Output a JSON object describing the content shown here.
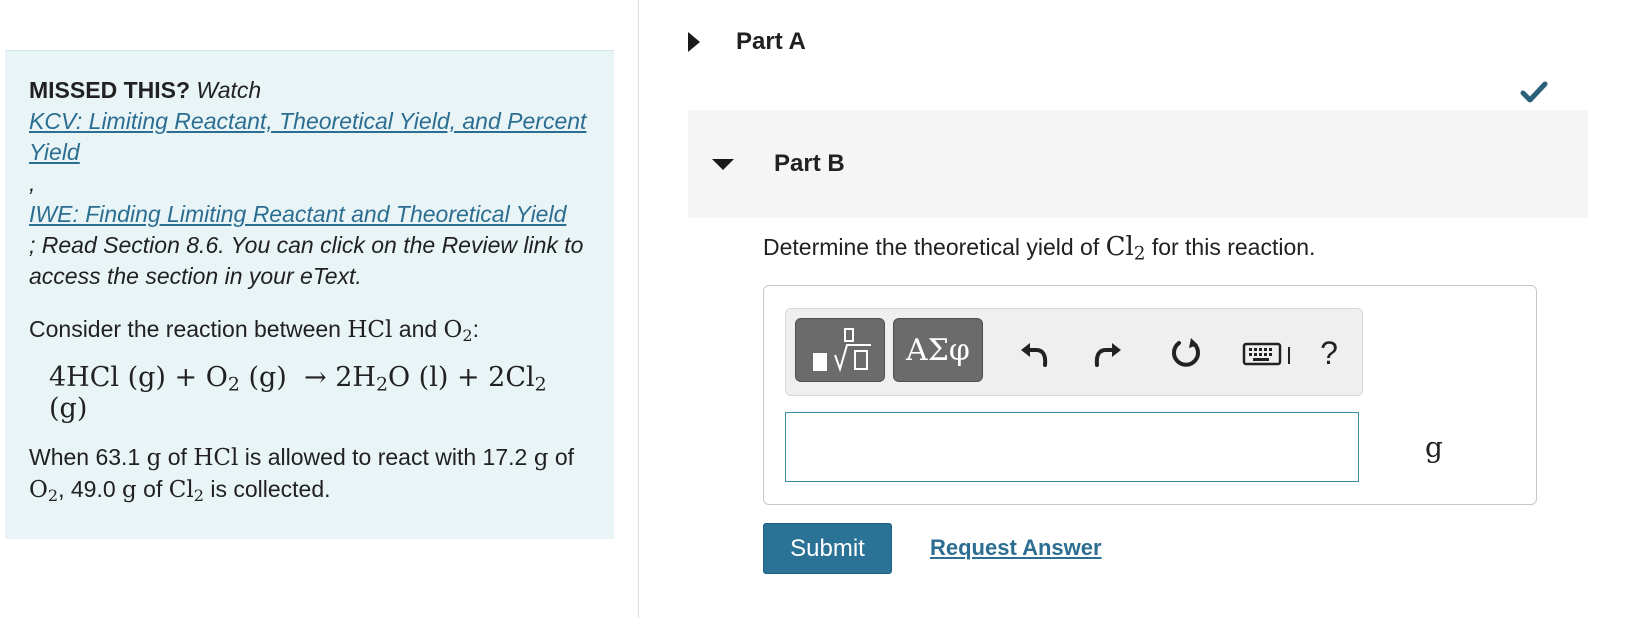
{
  "left": {
    "missed_label": "MISSED THIS?",
    "watch_label": "Watch",
    "link1": "KCV: Limiting Reactant, Theoretical Yield, and Percent Yield",
    "comma": ",",
    "link2": "IWE: Finding Limiting Reactant and Theoretical Yield",
    "read_text": "; Read Section 8.6. You can click on the Review link to access the section in your eText.",
    "consider_text": "Consider the reaction between",
    "hcl": "HCl",
    "and": "and",
    "o2_base": "O",
    "o2_sub": "2",
    "colon": ":",
    "equation": {
      "c1": "4HCl (g) + O",
      "s1": "2",
      "c2": " (g)  → 2H",
      "s2": "2",
      "c3": "O (l) + 2Cl",
      "s3": "2",
      "c4": " (g)"
    },
    "when": {
      "t1": "When 63.1",
      "u1": "g",
      "t2": "of",
      "m1": "HCl",
      "t3": "is allowed to react with 17.2",
      "u2": "g",
      "t4": "of",
      "m2": "O",
      "m2s": "2",
      "t5": ", 49.0",
      "u3": "g",
      "t6": "of",
      "m3": "Cl",
      "m3s": "2",
      "t7": "is collected."
    }
  },
  "right": {
    "part_a": "Part A",
    "part_b": "Part B",
    "question": {
      "t1": "Determine the theoretical yield of",
      "m": "Cl",
      "ms": "2",
      "t2": "for this reaction."
    },
    "toolbar": {
      "symbols_label": "ΑΣφ",
      "help_label": "?"
    },
    "input_value": "",
    "unit": "g",
    "submit_label": "Submit",
    "request_label": "Request Answer"
  },
  "colors": {
    "panel_bg": "#e9f4f6",
    "link": "#2c6e91",
    "submit_bg": "#2a7296",
    "check": "#2c5f78"
  },
  "icons": [
    "templates-icon",
    "undo-icon",
    "redo-icon",
    "reset-icon",
    "keyboard-icon",
    "check-icon"
  ]
}
